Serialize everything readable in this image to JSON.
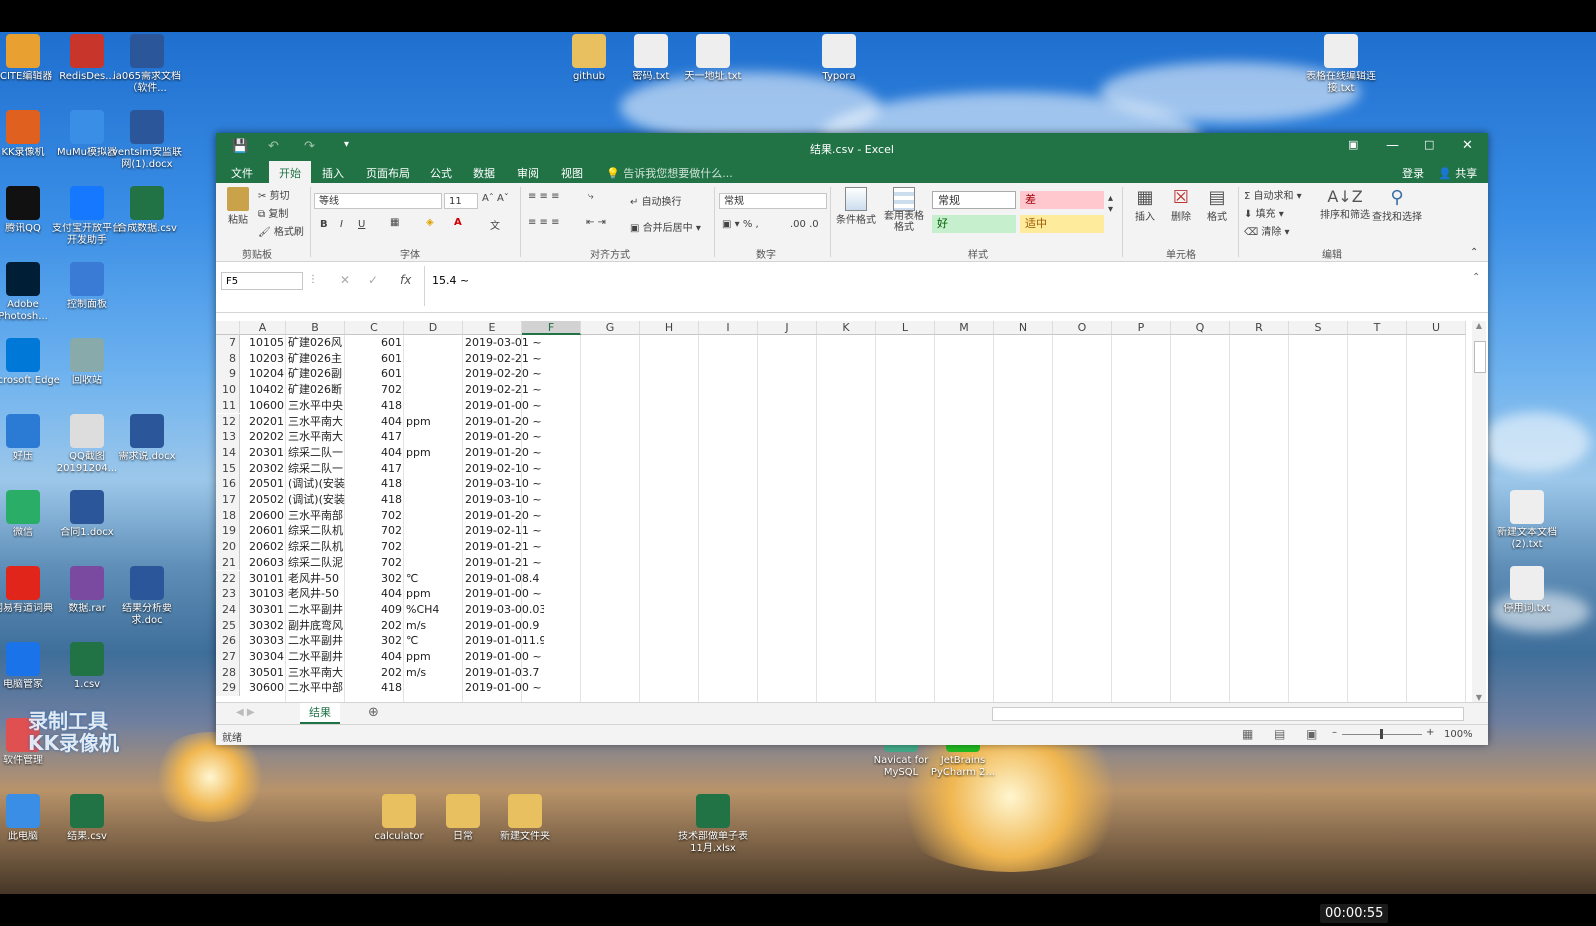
{
  "recording_time": "00:00:55",
  "watermark": [
    "录制工具",
    "KK录像机"
  ],
  "desktop_icons": [
    {
      "label": "SCITE编辑器",
      "icon": "scite-icon",
      "color": "#e8a030"
    },
    {
      "label": "RedisDes...",
      "icon": "redis-icon",
      "color": "#c8352a"
    },
    {
      "label": "ia065需求文档（软件...",
      "icon": "word-icon",
      "color": "#2b579a"
    },
    {
      "label": "KK录像机",
      "icon": "kk-recorder-icon",
      "color": "#e06020"
    },
    {
      "label": "MuMu模拟器",
      "icon": "mumu-icon",
      "color": "#3a8ee6"
    },
    {
      "label": "ventsim安监联网(1).docx",
      "icon": "word-icon",
      "color": "#2b579a"
    },
    {
      "label": "腾讯QQ",
      "icon": "qq-icon",
      "color": "#111"
    },
    {
      "label": "支付宝开放平台开发助手",
      "icon": "alipay-icon",
      "color": "#1677ff"
    },
    {
      "label": "合成数据.csv",
      "icon": "excel-icon",
      "color": "#217346"
    },
    {
      "label": "Adobe Photosh...",
      "icon": "photoshop-icon",
      "color": "#001e36"
    },
    {
      "label": "控制面板",
      "icon": "control-panel-icon",
      "color": "#3a7bd5"
    },
    {
      "label": "Microsoft Edge",
      "icon": "edge-icon",
      "color": "#0078d7"
    },
    {
      "label": "回收站",
      "icon": "recycle-bin-icon",
      "color": "#8aa"
    },
    {
      "label": "好压",
      "icon": "haozip-icon",
      "color": "#2b7bd5"
    },
    {
      "label": "QQ截图20191204...",
      "icon": "image-icon",
      "color": "#ddd"
    },
    {
      "label": "需求说.docx",
      "icon": "word-icon",
      "color": "#2b579a"
    },
    {
      "label": "微信",
      "icon": "wechat-icon",
      "color": "#2aae67"
    },
    {
      "label": "合同1.docx",
      "icon": "word-icon",
      "color": "#2b579a"
    },
    {
      "label": "网易有道词典",
      "icon": "youdao-icon",
      "color": "#e1251b"
    },
    {
      "label": "数据.rar",
      "icon": "rar-icon",
      "color": "#7a4aa0"
    },
    {
      "label": "结果分析要求.doc",
      "icon": "word-icon",
      "color": "#2b579a"
    },
    {
      "label": "电脑管家",
      "icon": "pc-manager-icon",
      "color": "#1a73e8"
    },
    {
      "label": "1.csv",
      "icon": "excel-icon",
      "color": "#217346"
    },
    {
      "label": "软件管理",
      "icon": "software-manager-icon",
      "color": "#e05050"
    },
    {
      "label": "此电脑",
      "icon": "this-pc-icon",
      "color": "#3a8ee6"
    },
    {
      "label": "结果.csv",
      "icon": "excel-icon",
      "color": "#217346"
    },
    {
      "label": "github",
      "icon": "folder-icon",
      "color": "#e8c060"
    },
    {
      "label": "密码.txt",
      "icon": "text-file-icon",
      "color": "#eee"
    },
    {
      "label": "天一地址.txt",
      "icon": "text-file-icon",
      "color": "#eee"
    },
    {
      "label": "Typora",
      "icon": "typora-icon",
      "color": "#eee"
    },
    {
      "label": "表格在线编辑连接.txt",
      "icon": "text-file-icon",
      "color": "#eee"
    },
    {
      "label": "新建文本文档(2).txt",
      "icon": "text-file-icon",
      "color": "#eee"
    },
    {
      "label": "停用词.txt",
      "icon": "text-file-icon",
      "color": "#eee"
    },
    {
      "label": "calculator",
      "icon": "folder-icon",
      "color": "#e8c060"
    },
    {
      "label": "日常",
      "icon": "folder-icon",
      "color": "#e8c060"
    },
    {
      "label": "新建文件夹",
      "icon": "folder-icon",
      "color": "#e8c060"
    },
    {
      "label": "技术部做单子表11月.xlsx",
      "icon": "excel-icon",
      "color": "#217346"
    },
    {
      "label": "Navicat for MySQL",
      "icon": "navicat-icon",
      "color": "#4a8"
    },
    {
      "label": "JetBrains PyCharm 2...",
      "icon": "pycharm-icon",
      "color": "#2b2"
    }
  ],
  "excel": {
    "title": "结果.csv - Excel",
    "tabs": [
      "文件",
      "开始",
      "插入",
      "页面布局",
      "公式",
      "数据",
      "审阅",
      "视图"
    ],
    "active_tab": "开始",
    "tell_me": "告诉我您想要做什么...",
    "login": "登录",
    "share": "共享",
    "clipboard": {
      "paste": "粘贴",
      "cut": "剪切",
      "copy": "复制",
      "format_painter": "格式刷",
      "group": "剪贴板"
    },
    "font": {
      "name": "等线",
      "size": "11",
      "group": "字体"
    },
    "alignment": {
      "wrap": "自动换行",
      "merge": "合并后居中",
      "group": "对齐方式"
    },
    "number": {
      "format": "常规",
      "group": "数字"
    },
    "styles": {
      "conditional": "条件格式",
      "table": "套用表格格式",
      "normal": "常规",
      "bad": "差",
      "good": "好",
      "neutral": "适中",
      "group": "样式"
    },
    "cells": {
      "insert": "插入",
      "delete": "删除",
      "format": "格式",
      "group": "单元格"
    },
    "editing": {
      "autosum": "自动求和",
      "fill": "填充",
      "clear": "清除",
      "sort": "排序和筛选",
      "find": "查找和选择",
      "group": "编辑"
    },
    "name_box": "F5",
    "formula": "15.4 ~",
    "columns": [
      "A",
      "B",
      "C",
      "D",
      "E",
      "F",
      "G",
      "H",
      "I",
      "J",
      "K",
      "L",
      "M",
      "N",
      "O",
      "P",
      "Q",
      "R",
      "S",
      "T",
      "U"
    ],
    "rows": [
      {
        "n": "7",
        "a": "10105",
        "b": "矿建026风",
        "c": "601",
        "d": "",
        "e": "2019-03-01 ~"
      },
      {
        "n": "8",
        "a": "10203",
        "b": "矿建026主",
        "c": "601",
        "d": "",
        "e": "2019-02-21 ~"
      },
      {
        "n": "9",
        "a": "10204",
        "b": "矿建026副",
        "c": "601",
        "d": "",
        "e": "2019-02-20 ~"
      },
      {
        "n": "10",
        "a": "10402",
        "b": "矿建026断",
        "c": "702",
        "d": "",
        "e": "2019-02-21 ~"
      },
      {
        "n": "11",
        "a": "10600",
        "b": "三水平中央",
        "c": "418",
        "d": "",
        "e": "2019-01-00 ~"
      },
      {
        "n": "12",
        "a": "20201",
        "b": "三水平南大",
        "c": "404",
        "d": "ppm",
        "e": "2019-01-20 ~"
      },
      {
        "n": "13",
        "a": "20202",
        "b": "三水平南大",
        "c": "417",
        "d": "",
        "e": "2019-01-20 ~"
      },
      {
        "n": "14",
        "a": "20301",
        "b": "综采二队一",
        "c": "404",
        "d": "ppm",
        "e": "2019-01-20 ~"
      },
      {
        "n": "15",
        "a": "20302",
        "b": "综采二队一",
        "c": "417",
        "d": "",
        "e": "2019-02-10 ~"
      },
      {
        "n": "16",
        "a": "20501",
        "b": "(调试)(安装",
        "c": "418",
        "d": "",
        "e": "2019-03-10 ~"
      },
      {
        "n": "17",
        "a": "20502",
        "b": "(调试)(安装",
        "c": "418",
        "d": "",
        "e": "2019-03-10 ~"
      },
      {
        "n": "18",
        "a": "20600",
        "b": "三水平南部",
        "c": "702",
        "d": "",
        "e": "2019-01-20 ~"
      },
      {
        "n": "19",
        "a": "20601",
        "b": "综采二队机",
        "c": "702",
        "d": "",
        "e": "2019-02-11 ~"
      },
      {
        "n": "20",
        "a": "20602",
        "b": "综采二队机",
        "c": "702",
        "d": "",
        "e": "2019-01-21 ~"
      },
      {
        "n": "21",
        "a": "20603",
        "b": "综采二队泥",
        "c": "702",
        "d": "",
        "e": "2019-01-21 ~"
      },
      {
        "n": "22",
        "a": "30101",
        "b": "老风井-50",
        "c": "302",
        "d": "℃",
        "e": "2019-01-08.4 ~"
      },
      {
        "n": "23",
        "a": "30103",
        "b": "老风井-50",
        "c": "404",
        "d": "ppm",
        "e": "2019-01-00 ~"
      },
      {
        "n": "24",
        "a": "30301",
        "b": "二水平副井",
        "c": "409",
        "d": "%CH4",
        "e": "2019-03-00.03 ~"
      },
      {
        "n": "25",
        "a": "30302",
        "b": "副井底弯风",
        "c": "202",
        "d": "m/s",
        "e": "2019-01-00.9 ~"
      },
      {
        "n": "26",
        "a": "30303",
        "b": "二水平副井",
        "c": "302",
        "d": "℃",
        "e": "2019-01-011.9 ~"
      },
      {
        "n": "27",
        "a": "30304",
        "b": "二水平副井",
        "c": "404",
        "d": "ppm",
        "e": "2019-01-00 ~"
      },
      {
        "n": "28",
        "a": "30501",
        "b": "三水平南大",
        "c": "202",
        "d": "m/s",
        "e": "2019-01-03.7 ~"
      },
      {
        "n": "29",
        "a": "30600",
        "b": "二水平中部",
        "c": "418",
        "d": "",
        "e": "2019-01-00 ~"
      }
    ],
    "sheet_tab": "结果",
    "status": "就绪",
    "zoom": "100%"
  }
}
